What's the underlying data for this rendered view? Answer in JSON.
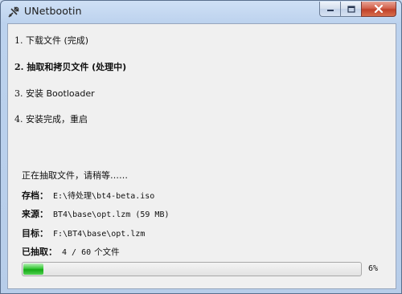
{
  "window": {
    "title": "UNetbootin",
    "icon": "unetbootin-app-icon",
    "buttons": {
      "minimize": "minimize-icon",
      "maximize": "maximize-icon",
      "close": "close-icon"
    }
  },
  "steps": [
    {
      "number": "1.",
      "label": "下载文件 (完成)"
    },
    {
      "number": "2.",
      "label": "抽取和拷贝文件 (处理中)"
    },
    {
      "number": "3.",
      "label": "安装 Bootloader"
    },
    {
      "number": "4.",
      "label": "安装完成，重启"
    }
  ],
  "status": "正在抽取文件，请稍等……",
  "details": {
    "archive_label": "存档：",
    "archive_value": "E:\\待处理\\bt4-beta.iso",
    "source_label": "来源：",
    "source_value": "BT4\\base\\opt.lzm (59 MB)",
    "target_label": "目标：",
    "target_value": "F:\\BT4\\base\\opt.lzm",
    "extracted_label": "已抽取：",
    "extracted_value": "4 / 60",
    "extracted_unit": "个文件"
  },
  "progress": {
    "percent": 6,
    "label": "6%"
  },
  "colors": {
    "progress_fill": "#1fb51f",
    "close_button": "#c7452f"
  }
}
